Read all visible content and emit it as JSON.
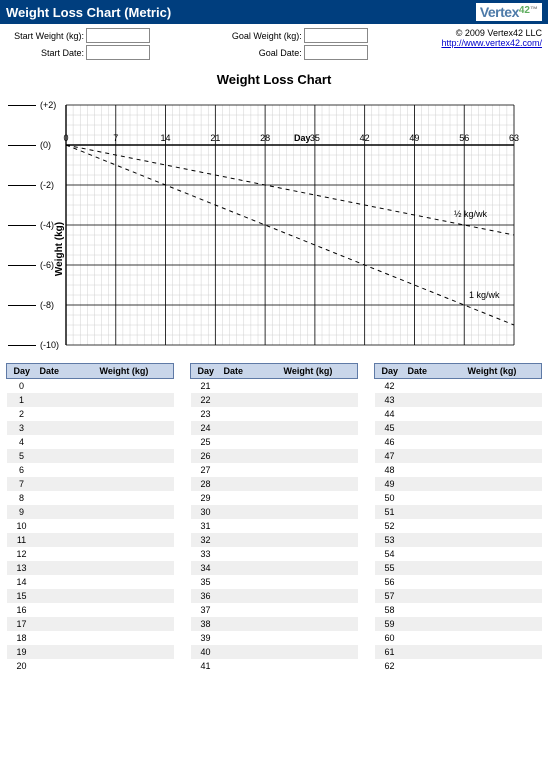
{
  "header": {
    "title": "Weight Loss Chart (Metric)",
    "logo_v": "Vertex",
    "logo_e": "",
    "logo_n": "42",
    "logo_tm": "™"
  },
  "form": {
    "start_weight_label": "Start Weight (kg):",
    "start_date_label": "Start Date:",
    "goal_weight_label": "Goal Weight (kg):",
    "goal_date_label": "Goal Date:",
    "start_weight": "",
    "start_date": "",
    "goal_weight": "",
    "goal_date": "",
    "copyright": "© 2009 Vertex42 LLC",
    "link_text": "http://www.vertex42.com/"
  },
  "chart": {
    "title": "Weight Loss Chart",
    "xlabel": "Day",
    "ylabel": "Weight  (kg)",
    "y_ticks": [
      "(+2)",
      "(0)",
      "(-2)",
      "(-4)",
      "(-6)",
      "(-8)",
      "(-10)"
    ],
    "x_ticks": [
      "0",
      "7",
      "14",
      "21",
      "28",
      "35",
      "42",
      "49",
      "56",
      "63"
    ],
    "line_half_label": "½ kg/wk",
    "line_one_label": "1 kg/wk"
  },
  "chart_data": {
    "type": "line",
    "title": "Weight Loss Chart",
    "xlabel": "Day",
    "ylabel": "Weight (kg)",
    "xlim": [
      0,
      63
    ],
    "ylim": [
      -10,
      2
    ],
    "x_ticks": [
      0,
      7,
      14,
      21,
      28,
      35,
      42,
      49,
      56,
      63
    ],
    "y_ticks": [
      2,
      0,
      -2,
      -4,
      -6,
      -8,
      -10
    ],
    "series": [
      {
        "name": "½ kg/wk",
        "x": [
          0,
          63
        ],
        "values": [
          0,
          -4.5
        ],
        "style": "dashed"
      },
      {
        "name": "1 kg/wk",
        "x": [
          0,
          63
        ],
        "values": [
          0,
          -9.0
        ],
        "style": "dashed"
      }
    ]
  },
  "tables": {
    "headers": [
      "Day",
      "Date",
      "Weight (kg)"
    ],
    "kg_suffix": "(kg)",
    "col1": [
      0,
      1,
      2,
      3,
      4,
      5,
      6,
      7,
      8,
      9,
      10,
      11,
      12,
      13,
      14,
      15,
      16,
      17,
      18,
      19,
      20
    ],
    "col2": [
      21,
      22,
      23,
      24,
      25,
      26,
      27,
      28,
      29,
      30,
      31,
      32,
      33,
      34,
      35,
      36,
      37,
      38,
      39,
      40,
      41
    ],
    "col3": [
      42,
      43,
      44,
      45,
      46,
      47,
      48,
      49,
      50,
      51,
      52,
      53,
      54,
      55,
      56,
      57,
      58,
      59,
      60,
      61,
      62
    ]
  }
}
